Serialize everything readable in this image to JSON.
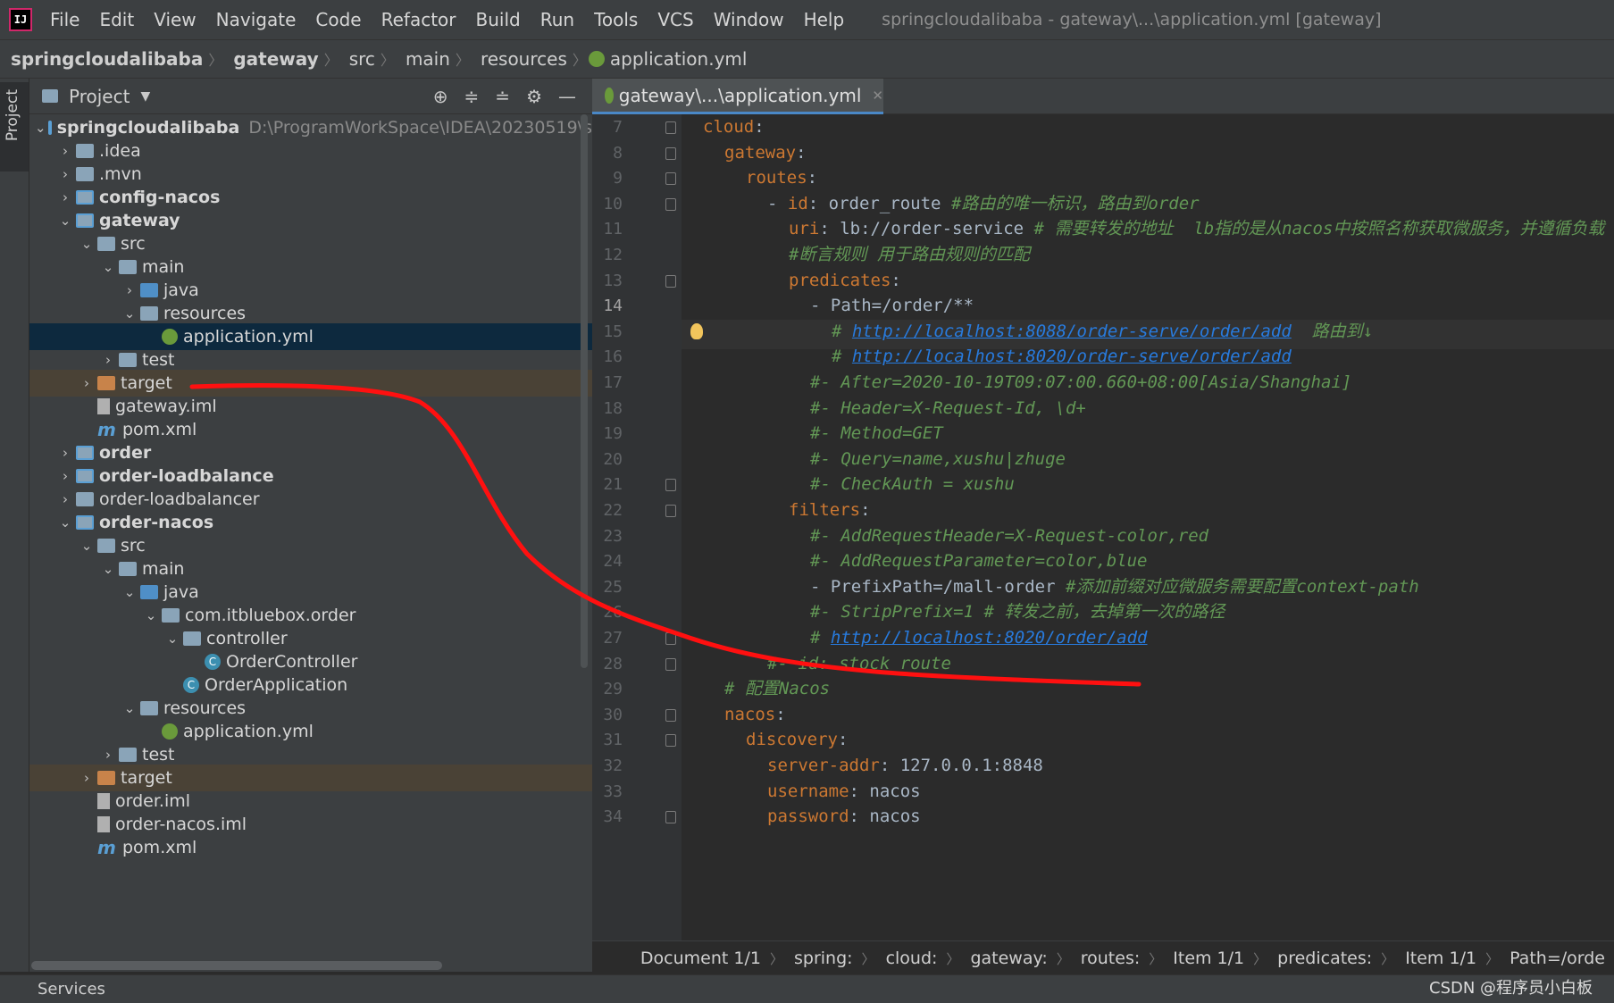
{
  "window_title": "springcloudalibaba - gateway\\...\\application.yml [gateway]",
  "logo_text": "IJ",
  "menu": [
    "File",
    "Edit",
    "View",
    "Navigate",
    "Code",
    "Refactor",
    "Build",
    "Run",
    "Tools",
    "VCS",
    "Window",
    "Help"
  ],
  "breadcrumb": [
    "springcloudalibaba",
    "gateway",
    "src",
    "main",
    "resources",
    "application.yml"
  ],
  "tool_strip_label": "Project",
  "project_panel": {
    "title": "Project",
    "tree": [
      {
        "label": "springcloudalibaba",
        "path": "D:\\ProgramWorkSpace\\IDEA\\20230519\\s",
        "level": 0,
        "expanded": true,
        "icon": "module-folder-icon",
        "bold": true
      },
      {
        "label": ".idea",
        "level": 1,
        "expanded": false,
        "icon": "folder-icon"
      },
      {
        "label": ".mvn",
        "level": 1,
        "expanded": false,
        "icon": "folder-icon"
      },
      {
        "label": "config-nacos",
        "level": 1,
        "expanded": false,
        "icon": "module-folder-icon",
        "bold": true
      },
      {
        "label": "gateway",
        "level": 1,
        "expanded": true,
        "icon": "module-folder-icon",
        "bold": true
      },
      {
        "label": "src",
        "level": 2,
        "expanded": true,
        "icon": "folder-icon"
      },
      {
        "label": "main",
        "level": 3,
        "expanded": true,
        "icon": "folder-icon"
      },
      {
        "label": "java",
        "level": 4,
        "expanded": false,
        "icon": "source-folder-icon"
      },
      {
        "label": "resources",
        "level": 4,
        "expanded": true,
        "icon": "resources-folder-icon"
      },
      {
        "label": "application.yml",
        "level": 5,
        "icon": "yml-file-icon",
        "selected": true
      },
      {
        "label": "test",
        "level": 3,
        "expanded": false,
        "icon": "folder-icon"
      },
      {
        "label": "target",
        "level": 2,
        "expanded": false,
        "icon": "excluded-folder-icon",
        "excluded": true
      },
      {
        "label": "gateway.iml",
        "level": 2,
        "icon": "iml-file-icon"
      },
      {
        "label": "pom.xml",
        "level": 2,
        "icon": "maven-file-icon"
      },
      {
        "label": "order",
        "level": 1,
        "expanded": false,
        "icon": "module-folder-icon",
        "bold": true
      },
      {
        "label": "order-loadbalance",
        "level": 1,
        "expanded": false,
        "icon": "module-folder-icon",
        "bold": true
      },
      {
        "label": "order-loadbalancer",
        "level": 1,
        "expanded": false,
        "icon": "folder-icon"
      },
      {
        "label": "order-nacos",
        "level": 1,
        "expanded": true,
        "icon": "module-folder-icon",
        "bold": true
      },
      {
        "label": "src",
        "level": 2,
        "expanded": true,
        "icon": "folder-icon"
      },
      {
        "label": "main",
        "level": 3,
        "expanded": true,
        "icon": "folder-icon"
      },
      {
        "label": "java",
        "level": 4,
        "expanded": true,
        "icon": "source-folder-icon"
      },
      {
        "label": "com.itbluebox.order",
        "level": 5,
        "expanded": true,
        "icon": "package-icon"
      },
      {
        "label": "controller",
        "level": 6,
        "expanded": true,
        "icon": "package-icon"
      },
      {
        "label": "OrderController",
        "level": 7,
        "icon": "class-icon"
      },
      {
        "label": "OrderApplication",
        "level": 6,
        "icon": "spring-class-icon"
      },
      {
        "label": "resources",
        "level": 4,
        "expanded": true,
        "icon": "resources-folder-icon"
      },
      {
        "label": "application.yml",
        "level": 5,
        "icon": "yml-file-icon"
      },
      {
        "label": "test",
        "level": 3,
        "expanded": false,
        "icon": "folder-icon"
      },
      {
        "label": "target",
        "level": 2,
        "expanded": false,
        "icon": "excluded-folder-icon",
        "excluded": true
      },
      {
        "label": "order.iml",
        "level": 2,
        "icon": "iml-file-icon"
      },
      {
        "label": "order-nacos.iml",
        "level": 2,
        "icon": "iml-file-icon"
      },
      {
        "label": "pom.xml",
        "level": 2,
        "icon": "maven-file-icon"
      }
    ]
  },
  "editor": {
    "tab_label": "gateway\\...\\application.yml",
    "current_line": 14,
    "lines": [
      {
        "n": 7,
        "indent": 0,
        "parts": [
          [
            "k",
            "cloud"
          ],
          [
            "v",
            ":"
          ]
        ],
        "fold": true
      },
      {
        "n": 8,
        "indent": 1,
        "parts": [
          [
            "k",
            "gateway"
          ],
          [
            "v",
            ":"
          ]
        ],
        "fold": true
      },
      {
        "n": 9,
        "indent": 2,
        "parts": [
          [
            "k",
            "routes"
          ],
          [
            "v",
            ":"
          ]
        ],
        "fold": true
      },
      {
        "n": 10,
        "indent": 3,
        "parts": [
          [
            "v",
            "- "
          ],
          [
            "k",
            "id"
          ],
          [
            "v",
            ": order_route "
          ],
          [
            "c",
            "#路由的唯一标识，路由到order"
          ]
        ],
        "fold": true
      },
      {
        "n": 11,
        "indent": 4,
        "parts": [
          [
            "k",
            "uri"
          ],
          [
            "v",
            ": lb://order-service "
          ],
          [
            "c",
            "# 需要转发的地址  lb指的是从nacos中按照名称获取微服务，并遵循负载"
          ]
        ]
      },
      {
        "n": 12,
        "indent": 4,
        "parts": [
          [
            "c",
            "#断言规则 用于路由规则的匹配"
          ]
        ]
      },
      {
        "n": 13,
        "indent": 4,
        "parts": [
          [
            "k",
            "predicates"
          ],
          [
            "v",
            ":"
          ]
        ],
        "fold": true
      },
      {
        "n": 14,
        "indent": 5,
        "parts": [
          [
            "v",
            "- Path=/order/**"
          ]
        ]
      },
      {
        "n": 15,
        "indent": 6,
        "parts": [
          [
            "c",
            "# "
          ],
          [
            "u",
            "http://localhost:8088/order-serve/order/add"
          ],
          [
            "c",
            "  路由到↓"
          ]
        ]
      },
      {
        "n": 16,
        "indent": 6,
        "parts": [
          [
            "c",
            "# "
          ],
          [
            "u",
            "http://localhost:8020/order-serve/order/add"
          ]
        ]
      },
      {
        "n": 17,
        "indent": 5,
        "parts": [
          [
            "c",
            "#- After=2020-10-19T09:07:00.660+08:00[Asia/Shanghai]"
          ]
        ]
      },
      {
        "n": 18,
        "indent": 5,
        "parts": [
          [
            "c",
            "#- Header=X-Request-Id, \\d+"
          ]
        ]
      },
      {
        "n": 19,
        "indent": 5,
        "parts": [
          [
            "c",
            "#- Method=GET"
          ]
        ]
      },
      {
        "n": 20,
        "indent": 5,
        "parts": [
          [
            "c",
            "#- Query=name,xushu|zhuge"
          ]
        ]
      },
      {
        "n": 21,
        "indent": 5,
        "parts": [
          [
            "c",
            "#- CheckAuth = xushu"
          ]
        ],
        "fold": true
      },
      {
        "n": 22,
        "indent": 4,
        "parts": [
          [
            "k",
            "filters"
          ],
          [
            "v",
            ":"
          ]
        ],
        "fold": true
      },
      {
        "n": 23,
        "indent": 5,
        "parts": [
          [
            "c",
            "#- AddRequestHeader=X-Request-color,red"
          ]
        ]
      },
      {
        "n": 24,
        "indent": 5,
        "parts": [
          [
            "c",
            "#- AddRequestParameter=color,blue"
          ]
        ]
      },
      {
        "n": 25,
        "indent": 5,
        "parts": [
          [
            "v",
            "- PrefixPath=/mall-order "
          ],
          [
            "c",
            "#添加前缀对应微服务需要配置context-path"
          ]
        ]
      },
      {
        "n": 26,
        "indent": 5,
        "parts": [
          [
            "c",
            "#- StripPrefix=1 # 转发之前，去掉第一次的路径"
          ]
        ]
      },
      {
        "n": 27,
        "indent": 5,
        "parts": [
          [
            "c",
            "# "
          ],
          [
            "u",
            "http://localhost:8020/order/add"
          ]
        ],
        "fold": true
      },
      {
        "n": 28,
        "indent": 3,
        "parts": [
          [
            "c",
            "#- id: stock_route"
          ]
        ],
        "fold": true
      },
      {
        "n": 29,
        "indent": 1,
        "parts": [
          [
            "c",
            "# 配置Nacos"
          ]
        ]
      },
      {
        "n": 30,
        "indent": 1,
        "parts": [
          [
            "k",
            "nacos"
          ],
          [
            "v",
            ":"
          ]
        ],
        "fold": true
      },
      {
        "n": 31,
        "indent": 2,
        "parts": [
          [
            "k",
            "discovery"
          ],
          [
            "v",
            ":"
          ]
        ],
        "fold": true
      },
      {
        "n": 32,
        "indent": 3,
        "parts": [
          [
            "k",
            "server-addr"
          ],
          [
            "v",
            ": 127.0.0.1:8848"
          ]
        ]
      },
      {
        "n": 33,
        "indent": 3,
        "parts": [
          [
            "k",
            "username"
          ],
          [
            "v",
            ": nacos"
          ]
        ]
      },
      {
        "n": 34,
        "indent": 3,
        "parts": [
          [
            "k",
            "password"
          ],
          [
            "v",
            ": nacos"
          ]
        ],
        "fold": true
      }
    ],
    "structure_path": [
      "Document 1/1",
      "spring:",
      "cloud:",
      "gateway:",
      "routes:",
      "Item 1/1",
      "predicates:",
      "Item 1/1",
      "Path=/orde"
    ]
  },
  "status": {
    "services_label": "Services",
    "watermark": "CSDN @程序员小白板"
  },
  "colors": {
    "key": "#cc7832",
    "comment": "#629755",
    "link": "#287bde",
    "annotation": "#ff0000"
  }
}
